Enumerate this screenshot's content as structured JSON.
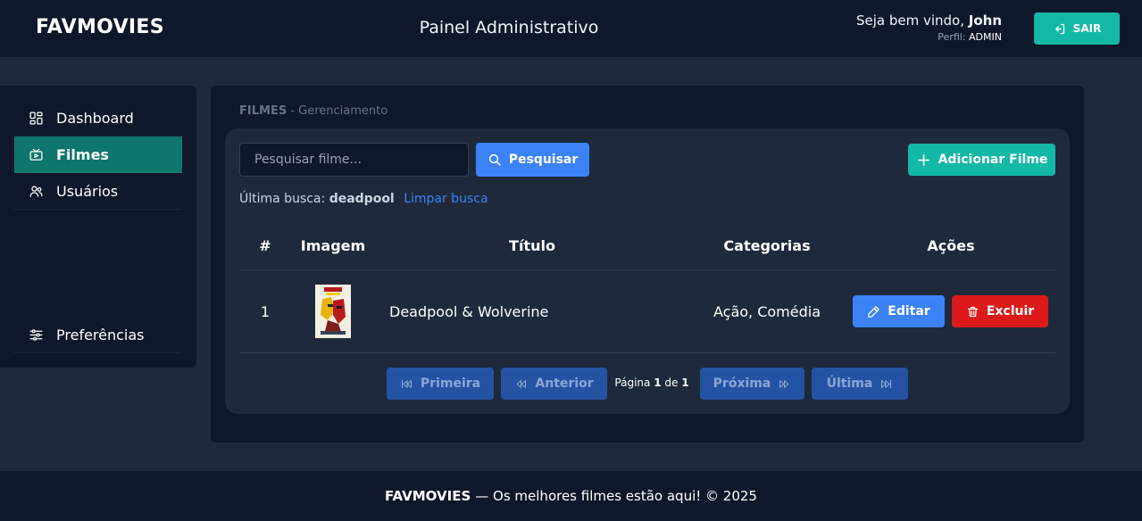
{
  "header": {
    "brand": "FAVMOVIES",
    "title": "Painel Administrativo",
    "welcome_prefix": "Seja bem vindo,",
    "user_name": "John",
    "profile_label": "Perfil:",
    "profile_value": "ADMIN",
    "logout_label": "SAIR"
  },
  "sidebar": {
    "items": [
      {
        "label": "Dashboard",
        "icon": "dashboard-icon"
      },
      {
        "label": "Filmes",
        "icon": "film-icon",
        "active": true
      },
      {
        "label": "Usuários",
        "icon": "users-icon"
      },
      {
        "label": "Preferências",
        "icon": "sliders-icon"
      }
    ]
  },
  "main": {
    "breadcrumb_section": "FILMES",
    "breadcrumb_sub": "- Gerenciamento",
    "search_placeholder": "Pesquisar filme...",
    "search_label": "Pesquisar",
    "add_label": "Adicionar Filme",
    "last_search_label": "Última busca:",
    "last_search_value": "deadpool",
    "clear_search_label": "Limpar busca",
    "table": {
      "headers": [
        "#",
        "Imagem",
        "Título",
        "Categorias",
        "Ações"
      ],
      "rows": [
        {
          "index": "1",
          "title": "Deadpool & Wolverine",
          "categories": "Ação, Comédia"
        }
      ],
      "edit_label": "Editar",
      "delete_label": "Excluir"
    },
    "pagination": {
      "first": "Primeira",
      "prev": "Anterior",
      "next": "Próxima",
      "last": "Última",
      "page_label": "Página",
      "current": "1",
      "of_label": "de",
      "total": "1"
    }
  },
  "footer": {
    "brand": "FAVMOVIES",
    "text": "— Os melhores filmes estão aqui! © 2025"
  },
  "colors": {
    "background": "#1e293b",
    "panel": "#0f172a",
    "accent_teal": "#14b8a6",
    "active_nav": "#0f766e",
    "primary_blue": "#3b82f6",
    "danger_red": "#dc1a1a"
  }
}
